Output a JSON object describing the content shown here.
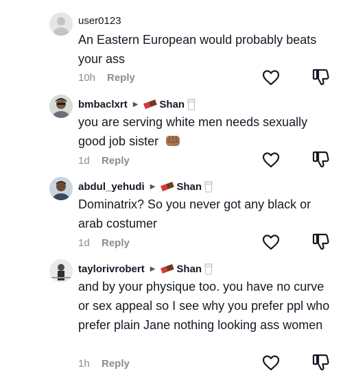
{
  "comments": [
    {
      "username": "user0123",
      "text": "An Eastern European would probably beats your ass",
      "time": "10h",
      "reply": "Reply",
      "reply_to": ""
    },
    {
      "username": "bmbaclxrt",
      "reply_to": "Shan",
      "text": "you are serving white men needs sexually good job sister",
      "emoji": "fist-icon",
      "time": "1d",
      "reply": "Reply"
    },
    {
      "username": "abdul_yehudi",
      "reply_to": "Shan",
      "text": "Dominatrix? So you never got any black or arab costumer",
      "time": "1d",
      "reply": "Reply"
    },
    {
      "username": "taylorivrobert",
      "reply_to": "Shan",
      "text": "and by your physique too. you have no curve or sex appeal so I see why you prefer ppl who prefer plain Jane nothing looking ass women",
      "time": "1h",
      "reply": "Reply"
    }
  ],
  "colors": {
    "text": "#161823",
    "secondary": "#8a8b91"
  },
  "icons": [
    "heart-icon",
    "dislike-icon",
    "chocolate-icon",
    "milk-icon",
    "fist-icon"
  ]
}
